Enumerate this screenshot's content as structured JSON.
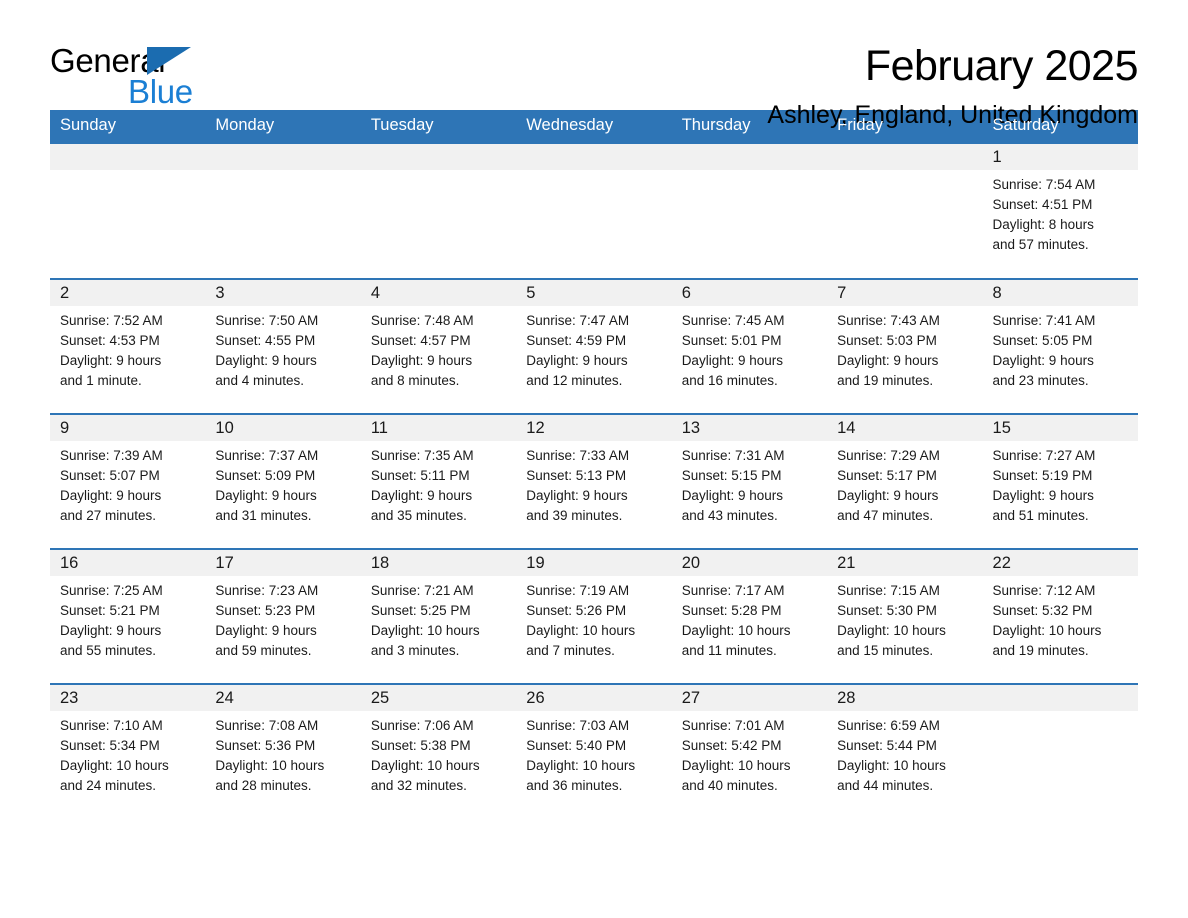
{
  "brand": {
    "name_part1": "General",
    "name_part2": "Blue",
    "accent_color": "#1b7fd4",
    "triangle_color": "#1b6cb0"
  },
  "header": {
    "title": "February 2025",
    "subtitle": "Ashley, England, United Kingdom"
  },
  "theme": {
    "header_row_color": "#2e75b6",
    "day_band_color": "#f1f1f1",
    "text_color": "#1a1a1a"
  },
  "weekday_headers": [
    "Sunday",
    "Monday",
    "Tuesday",
    "Wednesday",
    "Thursday",
    "Friday",
    "Saturday"
  ],
  "weeks": [
    [
      {
        "day": "",
        "empty": true
      },
      {
        "day": "",
        "empty": true
      },
      {
        "day": "",
        "empty": true
      },
      {
        "day": "",
        "empty": true
      },
      {
        "day": "",
        "empty": true
      },
      {
        "day": "",
        "empty": true
      },
      {
        "day": "1",
        "sunrise": "Sunrise: 7:54 AM",
        "sunset": "Sunset: 4:51 PM",
        "daylight_line1": "Daylight: 8 hours",
        "daylight_line2": "and 57 minutes."
      }
    ],
    [
      {
        "day": "2",
        "sunrise": "Sunrise: 7:52 AM",
        "sunset": "Sunset: 4:53 PM",
        "daylight_line1": "Daylight: 9 hours",
        "daylight_line2": "and 1 minute."
      },
      {
        "day": "3",
        "sunrise": "Sunrise: 7:50 AM",
        "sunset": "Sunset: 4:55 PM",
        "daylight_line1": "Daylight: 9 hours",
        "daylight_line2": "and 4 minutes."
      },
      {
        "day": "4",
        "sunrise": "Sunrise: 7:48 AM",
        "sunset": "Sunset: 4:57 PM",
        "daylight_line1": "Daylight: 9 hours",
        "daylight_line2": "and 8 minutes."
      },
      {
        "day": "5",
        "sunrise": "Sunrise: 7:47 AM",
        "sunset": "Sunset: 4:59 PM",
        "daylight_line1": "Daylight: 9 hours",
        "daylight_line2": "and 12 minutes."
      },
      {
        "day": "6",
        "sunrise": "Sunrise: 7:45 AM",
        "sunset": "Sunset: 5:01 PM",
        "daylight_line1": "Daylight: 9 hours",
        "daylight_line2": "and 16 minutes."
      },
      {
        "day": "7",
        "sunrise": "Sunrise: 7:43 AM",
        "sunset": "Sunset: 5:03 PM",
        "daylight_line1": "Daylight: 9 hours",
        "daylight_line2": "and 19 minutes."
      },
      {
        "day": "8",
        "sunrise": "Sunrise: 7:41 AM",
        "sunset": "Sunset: 5:05 PM",
        "daylight_line1": "Daylight: 9 hours",
        "daylight_line2": "and 23 minutes."
      }
    ],
    [
      {
        "day": "9",
        "sunrise": "Sunrise: 7:39 AM",
        "sunset": "Sunset: 5:07 PM",
        "daylight_line1": "Daylight: 9 hours",
        "daylight_line2": "and 27 minutes."
      },
      {
        "day": "10",
        "sunrise": "Sunrise: 7:37 AM",
        "sunset": "Sunset: 5:09 PM",
        "daylight_line1": "Daylight: 9 hours",
        "daylight_line2": "and 31 minutes."
      },
      {
        "day": "11",
        "sunrise": "Sunrise: 7:35 AM",
        "sunset": "Sunset: 5:11 PM",
        "daylight_line1": "Daylight: 9 hours",
        "daylight_line2": "and 35 minutes."
      },
      {
        "day": "12",
        "sunrise": "Sunrise: 7:33 AM",
        "sunset": "Sunset: 5:13 PM",
        "daylight_line1": "Daylight: 9 hours",
        "daylight_line2": "and 39 minutes."
      },
      {
        "day": "13",
        "sunrise": "Sunrise: 7:31 AM",
        "sunset": "Sunset: 5:15 PM",
        "daylight_line1": "Daylight: 9 hours",
        "daylight_line2": "and 43 minutes."
      },
      {
        "day": "14",
        "sunrise": "Sunrise: 7:29 AM",
        "sunset": "Sunset: 5:17 PM",
        "daylight_line1": "Daylight: 9 hours",
        "daylight_line2": "and 47 minutes."
      },
      {
        "day": "15",
        "sunrise": "Sunrise: 7:27 AM",
        "sunset": "Sunset: 5:19 PM",
        "daylight_line1": "Daylight: 9 hours",
        "daylight_line2": "and 51 minutes."
      }
    ],
    [
      {
        "day": "16",
        "sunrise": "Sunrise: 7:25 AM",
        "sunset": "Sunset: 5:21 PM",
        "daylight_line1": "Daylight: 9 hours",
        "daylight_line2": "and 55 minutes."
      },
      {
        "day": "17",
        "sunrise": "Sunrise: 7:23 AM",
        "sunset": "Sunset: 5:23 PM",
        "daylight_line1": "Daylight: 9 hours",
        "daylight_line2": "and 59 minutes."
      },
      {
        "day": "18",
        "sunrise": "Sunrise: 7:21 AM",
        "sunset": "Sunset: 5:25 PM",
        "daylight_line1": "Daylight: 10 hours",
        "daylight_line2": "and 3 minutes."
      },
      {
        "day": "19",
        "sunrise": "Sunrise: 7:19 AM",
        "sunset": "Sunset: 5:26 PM",
        "daylight_line1": "Daylight: 10 hours",
        "daylight_line2": "and 7 minutes."
      },
      {
        "day": "20",
        "sunrise": "Sunrise: 7:17 AM",
        "sunset": "Sunset: 5:28 PM",
        "daylight_line1": "Daylight: 10 hours",
        "daylight_line2": "and 11 minutes."
      },
      {
        "day": "21",
        "sunrise": "Sunrise: 7:15 AM",
        "sunset": "Sunset: 5:30 PM",
        "daylight_line1": "Daylight: 10 hours",
        "daylight_line2": "and 15 minutes."
      },
      {
        "day": "22",
        "sunrise": "Sunrise: 7:12 AM",
        "sunset": "Sunset: 5:32 PM",
        "daylight_line1": "Daylight: 10 hours",
        "daylight_line2": "and 19 minutes."
      }
    ],
    [
      {
        "day": "23",
        "sunrise": "Sunrise: 7:10 AM",
        "sunset": "Sunset: 5:34 PM",
        "daylight_line1": "Daylight: 10 hours",
        "daylight_line2": "and 24 minutes."
      },
      {
        "day": "24",
        "sunrise": "Sunrise: 7:08 AM",
        "sunset": "Sunset: 5:36 PM",
        "daylight_line1": "Daylight: 10 hours",
        "daylight_line2": "and 28 minutes."
      },
      {
        "day": "25",
        "sunrise": "Sunrise: 7:06 AM",
        "sunset": "Sunset: 5:38 PM",
        "daylight_line1": "Daylight: 10 hours",
        "daylight_line2": "and 32 minutes."
      },
      {
        "day": "26",
        "sunrise": "Sunrise: 7:03 AM",
        "sunset": "Sunset: 5:40 PM",
        "daylight_line1": "Daylight: 10 hours",
        "daylight_line2": "and 36 minutes."
      },
      {
        "day": "27",
        "sunrise": "Sunrise: 7:01 AM",
        "sunset": "Sunset: 5:42 PM",
        "daylight_line1": "Daylight: 10 hours",
        "daylight_line2": "and 40 minutes."
      },
      {
        "day": "28",
        "sunrise": "Sunrise: 6:59 AM",
        "sunset": "Sunset: 5:44 PM",
        "daylight_line1": "Daylight: 10 hours",
        "daylight_line2": "and 44 minutes."
      },
      {
        "day": "",
        "empty": true
      }
    ]
  ]
}
